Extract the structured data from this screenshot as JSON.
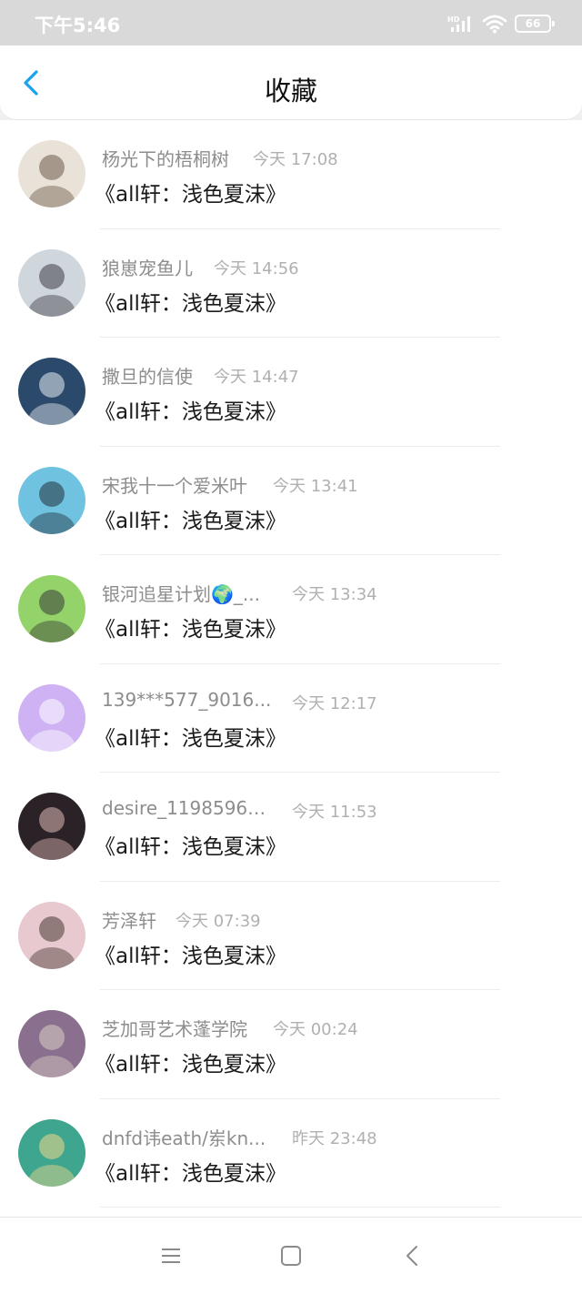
{
  "status_bar": {
    "time": "下午5:46",
    "network": "HD",
    "battery": "66"
  },
  "header": {
    "title": "收藏",
    "back_icon": "chevron-left-icon"
  },
  "colors": {
    "accent": "#1aa1f0",
    "name_text": "#8d8d8d",
    "time_text": "#b0b0b0",
    "content_text": "#1a1a1a"
  },
  "favorites": [
    {
      "name": "杨光下的梧桐树",
      "time": "今天 17:08",
      "content": "《all轩：浅色夏沫》",
      "avatar_colors": [
        "#e9e2d8",
        "#6d5a4a"
      ]
    },
    {
      "name": "狼崽宠鱼儿",
      "time": "今天 14:56",
      "content": "《all轩：浅色夏沫》",
      "avatar_colors": [
        "#cfd6dc",
        "#3e3f45"
      ]
    },
    {
      "name": "撒旦的信使",
      "time": "今天 14:47",
      "content": "《all轩：浅色夏沫》",
      "avatar_colors": [
        "#2b4a6b",
        "#e8edf2"
      ]
    },
    {
      "name": "宋我十一个爱米叶",
      "time": "今天 13:41",
      "content": "《all轩：浅色夏沫》",
      "avatar_colors": [
        "#6fc3e0",
        "#24303d"
      ]
    },
    {
      "name": "银河追星计划🌍_...",
      "time": "今天 13:34",
      "content": "《all轩：浅色夏沫》",
      "avatar_colors": [
        "#93d36a",
        "#3b3a38"
      ]
    },
    {
      "name": "139***577_9016...",
      "time": "今天 12:17",
      "content": "《all轩：浅色夏沫》",
      "avatar_colors": [
        "#cfb2f3",
        "#ffffff"
      ]
    },
    {
      "name": "desire_11985960...",
      "time": "今天 11:53",
      "content": "《all轩：浅色夏沫》",
      "avatar_colors": [
        "#2a2226",
        "#e0b9b6"
      ]
    },
    {
      "name": "芳泽轩",
      "time": "今天 07:39",
      "content": "《all轩：浅色夏沫》",
      "avatar_colors": [
        "#e7c9cf",
        "#4a3a34"
      ]
    },
    {
      "name": "芝加哥艺术蓬学院",
      "time": "今天 00:24",
      "content": "《all轩：浅色夏沫》",
      "avatar_colors": [
        "#8b6f8e",
        "#d8cfc3"
      ]
    },
    {
      "name": "dnfd讳eath/岽kn...",
      "time": "昨天 23:48",
      "content": "《all轩：浅色夏沫》",
      "avatar_colors": [
        "#3ea58e",
        "#f0d98a"
      ]
    }
  ],
  "nav_bar": {
    "menu_icon": "menu-icon",
    "home_icon": "home-square-icon",
    "back_icon": "back-triangle-icon"
  }
}
